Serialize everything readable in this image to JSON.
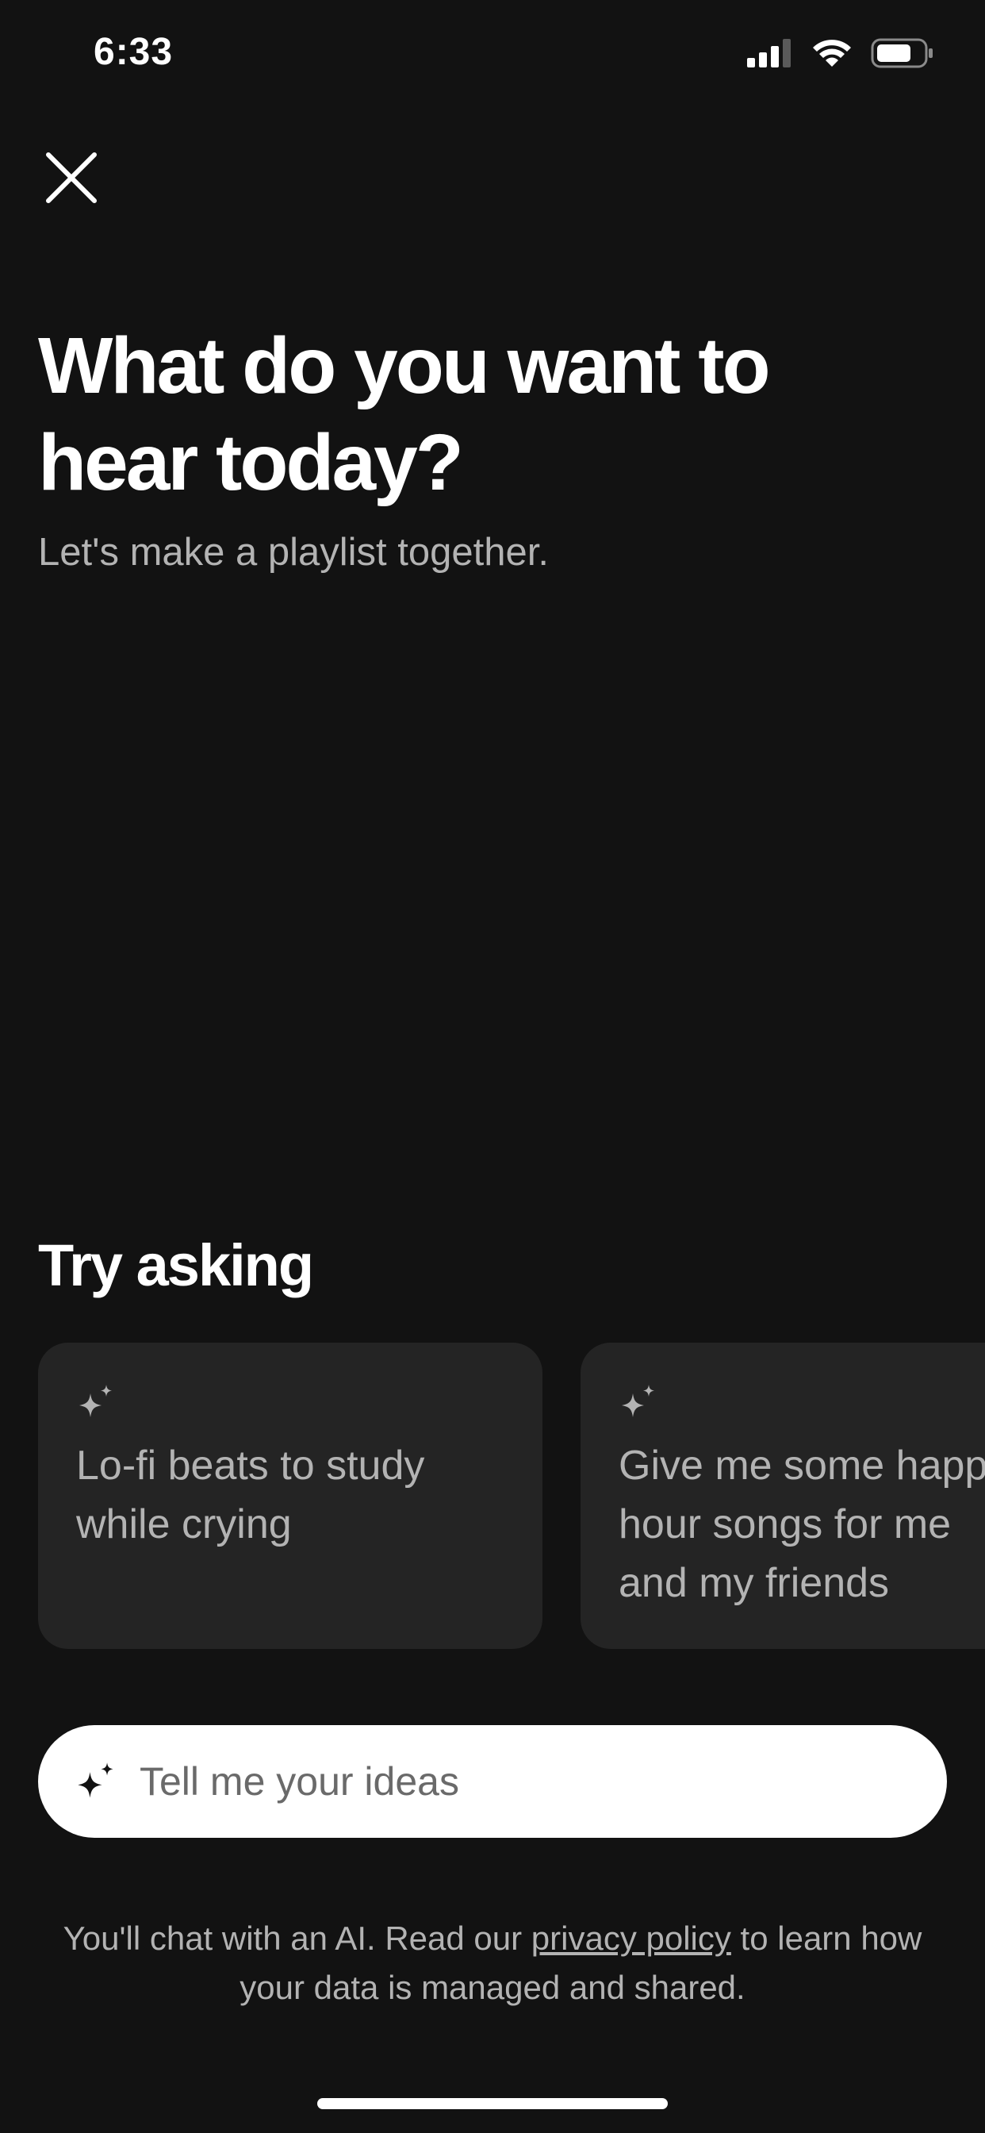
{
  "status_bar": {
    "time": "6:33",
    "icons": [
      "cellular-signal-icon",
      "wifi-icon",
      "battery-icon"
    ]
  },
  "header": {
    "close_icon": "close-icon",
    "title": "What do you want to hear today?",
    "subtitle": "Let's make a playlist together."
  },
  "suggestions": {
    "heading": "Try asking",
    "icon": "sparkle-icon",
    "items": [
      {
        "text": "Lo-fi beats to study\nwhile crying"
      },
      {
        "text": "Give me some happy\nhour songs for me\nand my friends"
      }
    ]
  },
  "prompt_input": {
    "icon": "sparkle-icon",
    "placeholder": "Tell me your ideas",
    "value": ""
  },
  "disclaimer": {
    "before_link": "You'll chat with an AI. Read our ",
    "link_text": "privacy policy",
    "after_link": " to learn how your data is managed and shared."
  },
  "colors": {
    "background": "#121212",
    "card_background": "#242424",
    "text_primary": "#ffffff",
    "text_secondary": "#b3b3b3",
    "input_background": "#ffffff"
  }
}
